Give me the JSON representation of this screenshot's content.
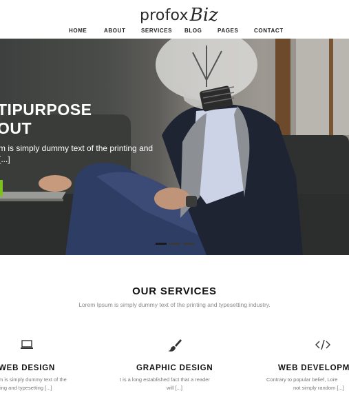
{
  "brand": {
    "logo_main": "profox",
    "logo_accent": "Biz"
  },
  "nav": {
    "items": [
      "HOME",
      "ABOUT",
      "SERVICES",
      "BLOG",
      "PAGES",
      "CONTACT"
    ]
  },
  "hero": {
    "title_line1": "TIPURPOSE",
    "title_line2": "OUT",
    "text_line1": "m is simply dummy text of the printing and",
    "text_line2": "[...]"
  },
  "services": {
    "title": "OUR SERVICES",
    "subtitle": "Lorem Ipsum is simply dummy text of the printing and typesetting industry.",
    "items": [
      {
        "icon": "laptop-icon",
        "title": "WEB DESIGN",
        "line1": "m is simply dummy text of the",
        "line2": "ting and typesetting [...]"
      },
      {
        "icon": "paintbrush-icon",
        "title": "GRAPHIC DESIGN",
        "line1": "t is a long established fact that a reader",
        "line2": "will [...]"
      },
      {
        "icon": "code-icon",
        "title": "WEB DEVELOPM",
        "line1": "Contrary to popular belief, Lore",
        "line2": "not simply random [...]"
      }
    ]
  },
  "colors": {
    "accent_green": "#7dc11e",
    "hero_dark": "#3d403e",
    "text_dark": "#111111",
    "text_muted": "#8a8a8a"
  }
}
